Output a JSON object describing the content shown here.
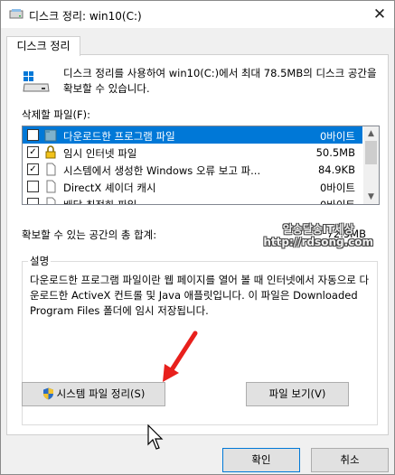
{
  "window": {
    "title": "디스크 정리: win10(C:)",
    "close_glyph": "✕"
  },
  "tab": {
    "label": "디스크 정리"
  },
  "intro": {
    "text": "디스크 정리를 사용하여 win10(C:)에서 최대 78.5MB의 디스크 공간을 확보할 수 있습니다."
  },
  "files": {
    "label": "삭제할 파일(F):",
    "items": [
      {
        "name": "다운로드한 프로그램 파일",
        "size": "0바이트",
        "checked": "",
        "selected": true,
        "icon": "folder-icon"
      },
      {
        "name": "임시 인터넷 파일",
        "size": "50.5MB",
        "checked": "✓",
        "selected": false,
        "icon": "lock-icon"
      },
      {
        "name": "시스템에서 생성한 Windows 오류 보고 파...",
        "size": "84.9KB",
        "checked": "✓",
        "selected": false,
        "icon": "document-icon"
      },
      {
        "name": "DirectX 셰이더 캐시",
        "size": "0바이트",
        "checked": "",
        "selected": false,
        "icon": "document-icon"
      },
      {
        "name": "배달 최적화 파일",
        "size": "0바이트",
        "checked": "",
        "selected": false,
        "icon": "document-icon"
      }
    ]
  },
  "space": {
    "label": "확보할 수 있는 공간의 총 합계:",
    "value": "72.5MB"
  },
  "description": {
    "legend": "설명",
    "text": "다운로드한 프로그램 파일이란 웹 페이지를 열어 볼 때 인터넷에서 자동으로 다운로드한 ActiveX 컨트롤 및 Java 애플릿입니다. 이 파일은 Downloaded Program Files 폴더에 임시 저장됩니다."
  },
  "buttons": {
    "cleanup": "시스템 파일 정리(S)",
    "view": "파일 보기(V)",
    "ok": "확인",
    "cancel": "취소"
  },
  "watermark": {
    "line1": "알송달송IT세상",
    "line2": "http://rdsong.com"
  },
  "colors": {
    "selection": "#0078d7",
    "arrow": "#e8201c"
  }
}
